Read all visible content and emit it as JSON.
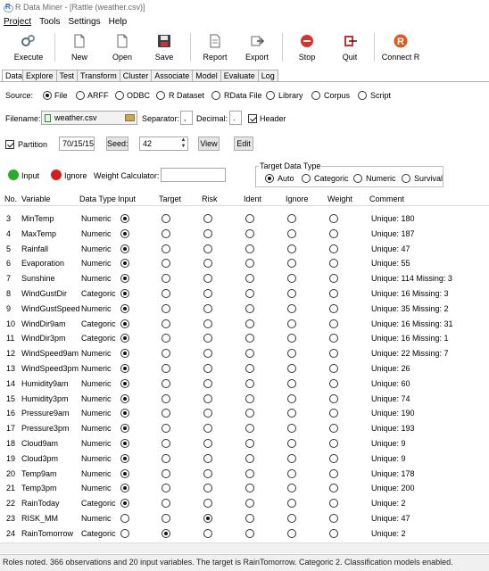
{
  "window": {
    "title": "R Data Miner - [Rattle (weather.csv)]"
  },
  "menu": [
    "Project",
    "Tools",
    "Settings",
    "Help"
  ],
  "toolbar": [
    {
      "label": "Execute",
      "icon": "gears-icon"
    },
    {
      "label": "New",
      "icon": "new-document-icon"
    },
    {
      "label": "Open",
      "icon": "open-document-icon"
    },
    {
      "label": "Save",
      "icon": "save-disk-icon"
    },
    {
      "label": "Report",
      "icon": "report-icon"
    },
    {
      "label": "Export",
      "icon": "export-icon"
    },
    {
      "label": "Stop",
      "icon": "stop-icon"
    },
    {
      "label": "Quit",
      "icon": "quit-icon"
    },
    {
      "label": "Connect R",
      "icon": "r-logo-icon"
    }
  ],
  "tabs": [
    "Data",
    "Explore",
    "Test",
    "Transform",
    "Cluster",
    "Associate",
    "Model",
    "Evaluate",
    "Log"
  ],
  "active_tab": "Data",
  "source": {
    "label": "Source:",
    "options": [
      "File",
      "ARFF",
      "ODBC",
      "R Dataset",
      "RData File",
      "Library",
      "Corpus",
      "Script"
    ],
    "selected": "File"
  },
  "file": {
    "filename_label": "Filename:",
    "filename": "weather.csv",
    "separator_label": "Separator:",
    "separator": ",",
    "decimal_label": "Decimal:",
    "decimal": ".",
    "header_label": "Header"
  },
  "partition": {
    "label": "Partition",
    "value": "70/15/15",
    "seed_label": "Seed:",
    "seed": "42",
    "view_label": "View",
    "edit_label": "Edit"
  },
  "roles": {
    "input_label": "Input",
    "ignore_label": "Ignore",
    "weight_label": "Weight Calculator:",
    "target_type_label": "Target Data Type",
    "target_types": [
      "Auto",
      "Categoric",
      "Numeric",
      "Survival"
    ],
    "target_type_selected": "Auto"
  },
  "columns": [
    "No.",
    "Variable",
    "Data Type",
    "Input",
    "Target",
    "Risk",
    "Ident",
    "Ignore",
    "Weight",
    "Comment"
  ],
  "rows": [
    {
      "no": "3",
      "var": "MinTemp",
      "type": "Numeric",
      "role": "input",
      "comment": "Unique: 180"
    },
    {
      "no": "4",
      "var": "MaxTemp",
      "type": "Numeric",
      "role": "input",
      "comment": "Unique: 187"
    },
    {
      "no": "5",
      "var": "Rainfall",
      "type": "Numeric",
      "role": "input",
      "comment": "Unique: 47"
    },
    {
      "no": "6",
      "var": "Evaporation",
      "type": "Numeric",
      "role": "input",
      "comment": "Unique: 55"
    },
    {
      "no": "7",
      "var": "Sunshine",
      "type": "Numeric",
      "role": "input",
      "comment": "Unique: 114 Missing: 3"
    },
    {
      "no": "8",
      "var": "WindGustDir",
      "type": "Categoric",
      "role": "input",
      "comment": "Unique: 16 Missing: 3"
    },
    {
      "no": "9",
      "var": "WindGustSpeed",
      "type": "Numeric",
      "role": "input",
      "comment": "Unique: 35 Missing: 2"
    },
    {
      "no": "10",
      "var": "WindDir9am",
      "type": "Categoric",
      "role": "input",
      "comment": "Unique: 16 Missing: 31"
    },
    {
      "no": "11",
      "var": "WindDir3pm",
      "type": "Categoric",
      "role": "input",
      "comment": "Unique: 16 Missing: 1"
    },
    {
      "no": "12",
      "var": "WindSpeed9am",
      "type": "Numeric",
      "role": "input",
      "comment": "Unique: 22 Missing: 7"
    },
    {
      "no": "13",
      "var": "WindSpeed3pm",
      "type": "Numeric",
      "role": "input",
      "comment": "Unique: 26"
    },
    {
      "no": "14",
      "var": "Humidity9am",
      "type": "Numeric",
      "role": "input",
      "comment": "Unique: 60"
    },
    {
      "no": "15",
      "var": "Humidity3pm",
      "type": "Numeric",
      "role": "input",
      "comment": "Unique: 74"
    },
    {
      "no": "16",
      "var": "Pressure9am",
      "type": "Numeric",
      "role": "input",
      "comment": "Unique: 190"
    },
    {
      "no": "17",
      "var": "Pressure3pm",
      "type": "Numeric",
      "role": "input",
      "comment": "Unique: 193"
    },
    {
      "no": "18",
      "var": "Cloud9am",
      "type": "Numeric",
      "role": "input",
      "comment": "Unique: 9"
    },
    {
      "no": "19",
      "var": "Cloud3pm",
      "type": "Numeric",
      "role": "input",
      "comment": "Unique: 9"
    },
    {
      "no": "20",
      "var": "Temp9am",
      "type": "Numeric",
      "role": "input",
      "comment": "Unique: 178"
    },
    {
      "no": "21",
      "var": "Temp3pm",
      "type": "Numeric",
      "role": "input",
      "comment": "Unique: 200"
    },
    {
      "no": "22",
      "var": "RainToday",
      "type": "Categoric",
      "role": "input",
      "comment": "Unique: 2"
    },
    {
      "no": "23",
      "var": "RISK_MM",
      "type": "Numeric",
      "role": "risk",
      "comment": "Unique: 47"
    },
    {
      "no": "24",
      "var": "RainTomorrow",
      "type": "Categoric",
      "role": "target",
      "comment": "Unique: 2"
    }
  ],
  "status": "Roles noted. 366 observations and 20 input variables. The target is RainTomorrow. Categoric 2. Classification models enabled."
}
